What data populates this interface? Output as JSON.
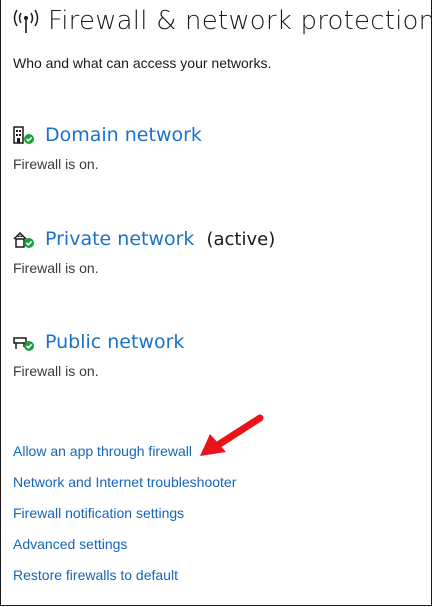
{
  "header": {
    "title": "Firewall & network protection",
    "subtitle": "Who and what can access your networks.",
    "icon": "broadcast-tower-icon"
  },
  "networks": [
    {
      "name": "Domain network",
      "active": "",
      "status": "Firewall is on.",
      "icon": "domain-building-icon"
    },
    {
      "name": "Private network",
      "active": "(active)",
      "status": "Firewall is on.",
      "icon": "home-network-icon"
    },
    {
      "name": "Public network",
      "active": "",
      "status": "Firewall is on.",
      "icon": "public-bench-icon"
    }
  ],
  "links": [
    "Allow an app through firewall",
    "Network and Internet troubleshooter",
    "Firewall notification settings",
    "Advanced settings",
    "Restore firewalls to default"
  ],
  "colors": {
    "link": "#1566b8",
    "network_link": "#1a73c9",
    "check": "#1b9e3b",
    "annotation_arrow": "#e8141a"
  }
}
